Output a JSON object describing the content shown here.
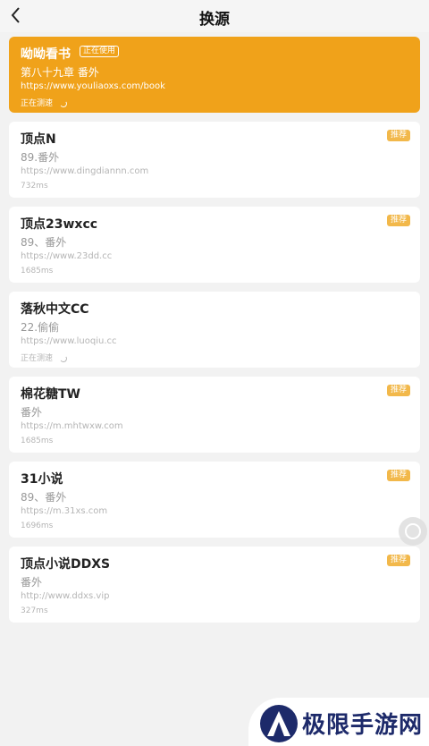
{
  "header": {
    "title": "换源",
    "back_icon": "chevron-left-icon"
  },
  "sources": [
    {
      "name": "呦呦看书",
      "badge": "正在使用",
      "chapter": "第八十九章 番外",
      "url": "https://www.youliaoxs.com/book",
      "speed": "正在测速",
      "active": true
    },
    {
      "name": "顶点N",
      "badge": "推荐",
      "chapter": "89.番外",
      "url": "https://www.dingdiannn.com",
      "speed": "732ms"
    },
    {
      "name": "顶点23wxcc",
      "badge": "推荐",
      "chapter": "89、番外",
      "url": "https://www.23dd.cc",
      "speed": "1685ms"
    },
    {
      "name": "落秋中文CC",
      "badge": "",
      "chapter": "22.偷偷",
      "url": "https://www.luoqiu.cc",
      "speed": "正在测速"
    },
    {
      "name": "棉花糖TW",
      "badge": "推荐",
      "chapter": "番外",
      "url": "https://m.mhtwxw.com",
      "speed": "1685ms"
    },
    {
      "name": "31小说",
      "badge": "推荐",
      "chapter": "89、番外",
      "url": "https://m.31xs.com",
      "speed": "1696ms"
    },
    {
      "name": "顶点小说DDXS",
      "badge": "推荐",
      "chapter": "番外",
      "url": "http://www.ddxs.vip",
      "speed": "327ms"
    }
  ],
  "watermark": {
    "text": "极限手游网"
  },
  "colors": {
    "accent": "#f0a21a",
    "badge": "#f2b84a",
    "watermark_text": "#1d2a6a"
  }
}
